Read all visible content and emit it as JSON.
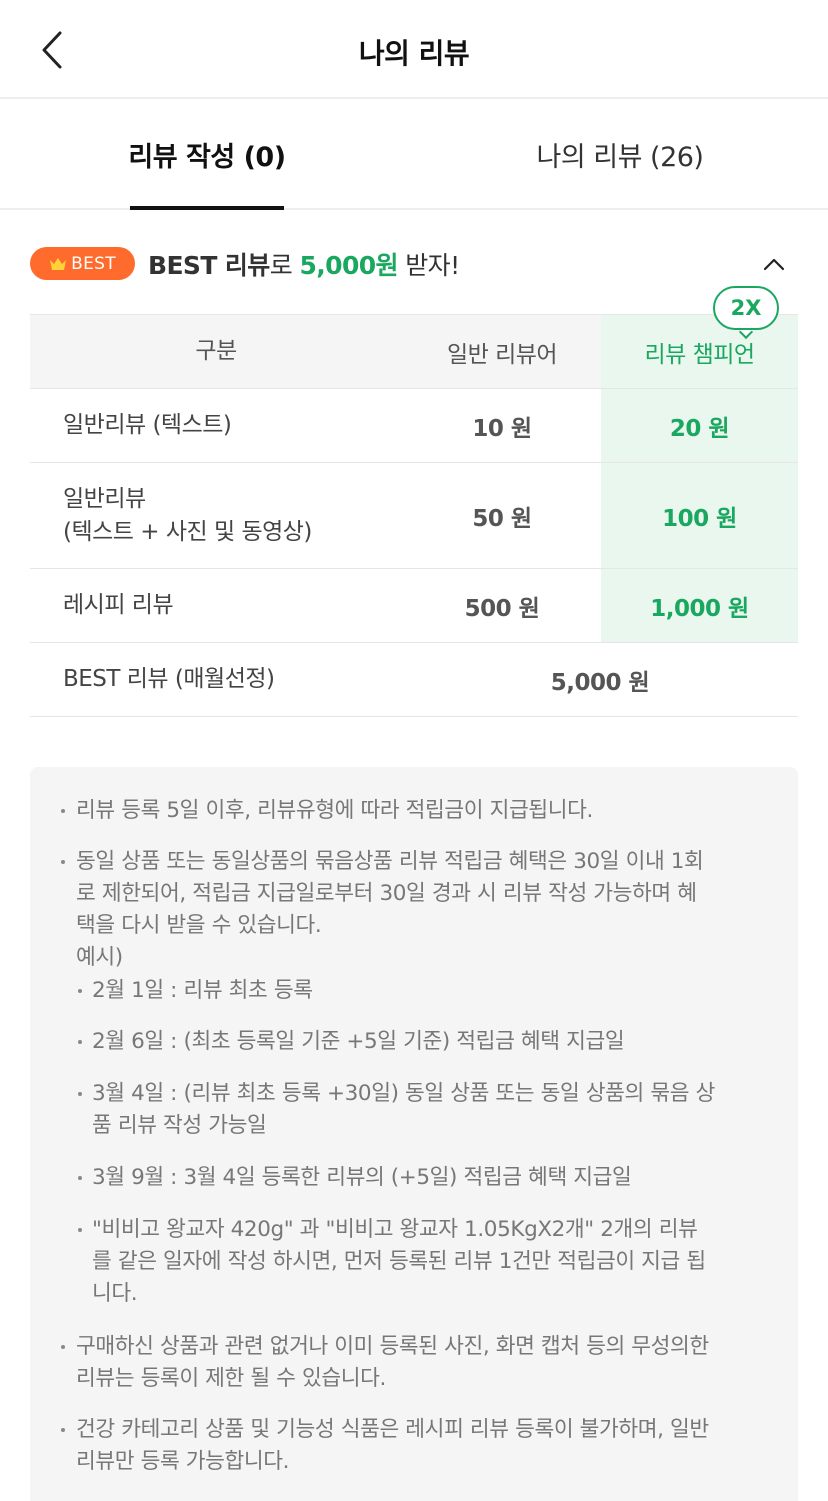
{
  "header": {
    "title": "나의 리뷰"
  },
  "tabs": [
    {
      "label": "리뷰 작성 (0)",
      "active": true
    },
    {
      "label": "나의 리뷰 (26)",
      "active": false
    }
  ],
  "best_banner": {
    "badge": "BEST",
    "text_bold": "BEST 리뷰",
    "text_mid": "로 ",
    "amount": "5,000원",
    "text_end": " 받자!"
  },
  "reward_table": {
    "multiplier": "2X",
    "headers": [
      "구분",
      "일반 리뷰어",
      "리뷰 챔피언"
    ],
    "rows": [
      {
        "type": "일반리뷰 (텍스트)",
        "normal": "10 원",
        "champion": "20 원"
      },
      {
        "type_line1": "일반리뷰",
        "type_line2": "(텍스트 + 사진 및 동영상)",
        "normal": "50 원",
        "champion": "100 원"
      },
      {
        "type": "레시피 리뷰",
        "normal": "500 원",
        "champion": "1,000 원"
      },
      {
        "type": "BEST 리뷰 (매월선정)",
        "merged": "5,000 원"
      }
    ]
  },
  "notice": {
    "p1": "리뷰 등록 5일 이후, 리뷰유형에 따라 적립금이 지급됩니다.",
    "p2_l1": "동일 상품 또는 동일상품의 묶음상품 리뷰 적립금 혜택은 30일 이내 1회",
    "p2_l2": "로 제한되어, 적립금 지급일로부터 30일 경과 시 리뷰 작성 가능하며 혜",
    "p2_l3": "택을 다시 받을 수 있습니다.",
    "p2_l4": "예시)",
    "ex1": "2월 1일 : 리뷰 최초 등록",
    "ex2": "2월 6일 : (최초 등록일 기준 +5일 기준) 적립금 혜택 지급일",
    "ex3_l1": "3월 4일 : (리뷰 최초 등록 +30일) 동일 상품 또는 동일 상품의 묶음 상",
    "ex3_l2": "품 리뷰 작성 가능일",
    "ex4": "3월 9월 : 3월 4일 등록한 리뷰의 (+5일) 적립금 혜택 지급일",
    "ex5_l1": "\"비비고 왕교자 420g\" 과 \"비비고 왕교자 1.05KgX2개\" 2개의 리뷰",
    "ex5_l2": "를 같은 일자에 작성 하시면, 먼저 등록된 리뷰 1건만 적립금이 지급 됩",
    "ex5_l3": "니다.",
    "p3_l1": "구매하신 상품과 관련 없거나 이미 등록된 사진, 화면 캡처 등의 무성의한",
    "p3_l2": "리뷰는 등록이 제한 될 수 있습니다.",
    "p4_l1": "건강 카테고리 상품 및 기능성 식품은 레시피 리뷰 등록이 불가하며, 일반",
    "p4_l2": "리뷰만 등록 가능합니다."
  },
  "colors": {
    "accent_green": "#1aa760",
    "best_orange": "#ff6b2c",
    "champion_bg": "#eaf7ef"
  },
  "icons": {
    "back": "chevron-left-icon",
    "collapse": "chevron-up-icon",
    "badge": "crown-icon"
  }
}
